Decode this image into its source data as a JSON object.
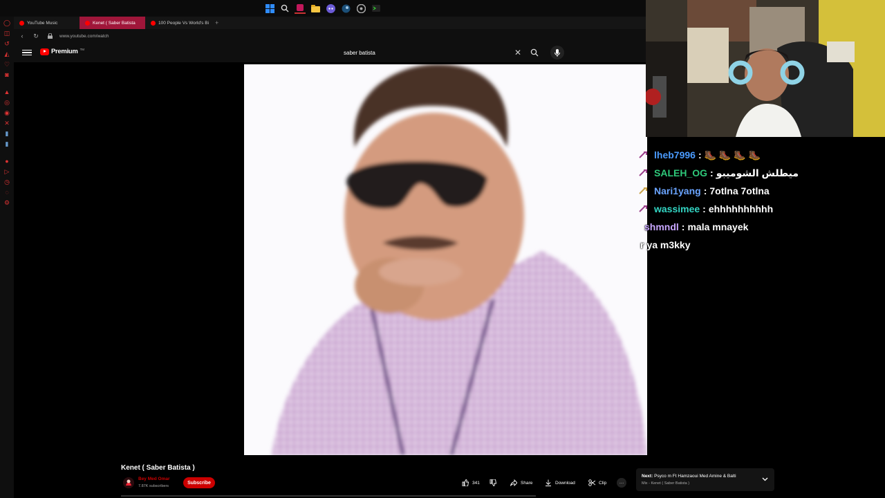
{
  "taskbar": {
    "icons": [
      "windows-icon",
      "search-icon",
      "app-icon",
      "folder-icon",
      "discord-icon",
      "steam-icon",
      "chrome-icon",
      "terminal-icon"
    ]
  },
  "browser": {
    "tabs": [
      {
        "label": "YouTube Music",
        "active": false
      },
      {
        "label": "Kenet ( Saber Batista",
        "active": true
      },
      {
        "label": "100 People Vs World's Bi",
        "active": false
      }
    ],
    "new_tab": "+",
    "url": "www.youtube.com/watch"
  },
  "youtube": {
    "logo_text": "Premium",
    "logo_tm": "TM",
    "search_value": "saber batista",
    "search_clear": "✕"
  },
  "chat": [
    {
      "user": "lheb7996",
      "sep": ":",
      "msg": "🥾 🥾 🥾 🥾",
      "color": "#4a9bff",
      "badge": "sword"
    },
    {
      "user": "SALEH_OG",
      "sep": ":",
      "msg": "ميطلش الشوميبو",
      "color": "#2ec97a",
      "badge": "sword"
    },
    {
      "user": "Nari1yang",
      "sep": ":",
      "msg": "7otlna 7otlna",
      "color": "#6aa4ff",
      "badge": "sword-gold"
    },
    {
      "user": "wassimee",
      "sep": ":",
      "msg": "ehhhhhhhhhh",
      "color": "#33d6c4",
      "badge": "sword"
    },
    {
      "user": "shmndl",
      "sep": ":",
      "msg": "mala mnayek",
      "color": "#c8a6ff",
      "badge": ""
    },
    {
      "user": "r",
      "sep": "",
      "msg": "ya m3kky",
      "color": "#ffffff",
      "badge": ""
    }
  ],
  "video": {
    "title": "Kenet ( Saber Batista )",
    "channel": "Bey Med Omar",
    "subscribers": "7.87K subscribers",
    "subscribe_label": "Subscribe",
    "likes": "341",
    "share_label": "Share",
    "download_label": "Download",
    "clip_label": "Clip",
    "more_label": "···"
  },
  "next": {
    "prefix": "Next:",
    "title": "Psyco m Ft Hamzaoui Med Amine & Balti",
    "subtitle": "Mix - Kenet ( Saber Batista )"
  },
  "colors": {
    "accent": "#ff0000",
    "tab_active": "#a0163a"
  }
}
